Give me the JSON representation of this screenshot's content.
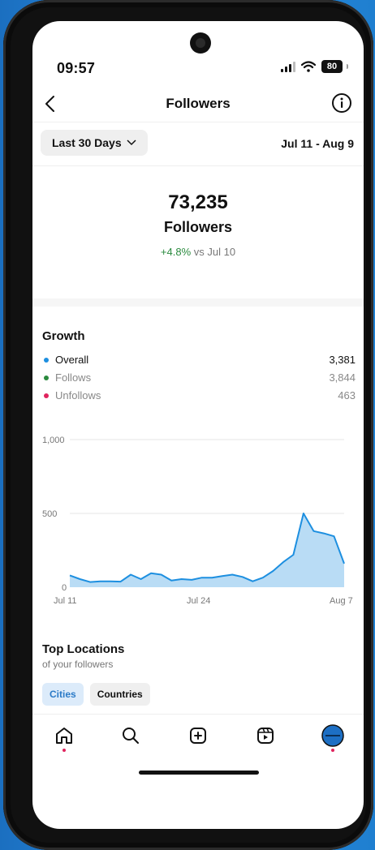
{
  "status": {
    "time": "09:57",
    "battery": "80"
  },
  "header": {
    "title": "Followers"
  },
  "range": {
    "button_label": "Last 30 Days",
    "dates": "Jul 11 - Aug 9"
  },
  "summary": {
    "count": "73,235",
    "label": "Followers",
    "change": "+4.8%",
    "change_suffix": "vs Jul 10"
  },
  "growth": {
    "title": "Growth",
    "rows": [
      {
        "label": "Overall",
        "value": "3,381",
        "color": "#1d8fe0",
        "text_color": "#111111"
      },
      {
        "label": "Follows",
        "value": "3,844",
        "color": "#2a8a3e",
        "text_color": "#888888"
      },
      {
        "label": "Unfollows",
        "value": "463",
        "color": "#e0245e",
        "text_color": "#888888"
      }
    ]
  },
  "chart_data": {
    "type": "area",
    "y_ticks": [
      "1,000",
      "500",
      "0"
    ],
    "x_ticks": [
      "Jul 11",
      "Jul 24",
      "Aug 7"
    ],
    "ylim": [
      0,
      1000
    ],
    "grid": true,
    "series": [
      {
        "values": [
          80,
          55,
          35,
          40,
          40,
          38,
          85,
          55,
          95,
          85,
          45,
          55,
          50,
          65,
          65,
          75,
          85,
          70,
          40,
          65,
          110,
          170,
          220,
          500,
          380,
          365,
          345,
          160
        ]
      }
    ],
    "color": "#1d8fe0",
    "fill": "#b9dcf5"
  },
  "locations": {
    "title": "Top Locations",
    "subtitle": "of your followers",
    "tabs": [
      {
        "label": "Cities",
        "active": true
      },
      {
        "label": "Countries",
        "active": false
      }
    ]
  },
  "tabbar": {
    "items": [
      {
        "name": "home",
        "dot": true
      },
      {
        "name": "search",
        "dot": false
      },
      {
        "name": "create",
        "dot": false
      },
      {
        "name": "reels",
        "dot": false
      },
      {
        "name": "profile",
        "dot": true
      }
    ]
  }
}
